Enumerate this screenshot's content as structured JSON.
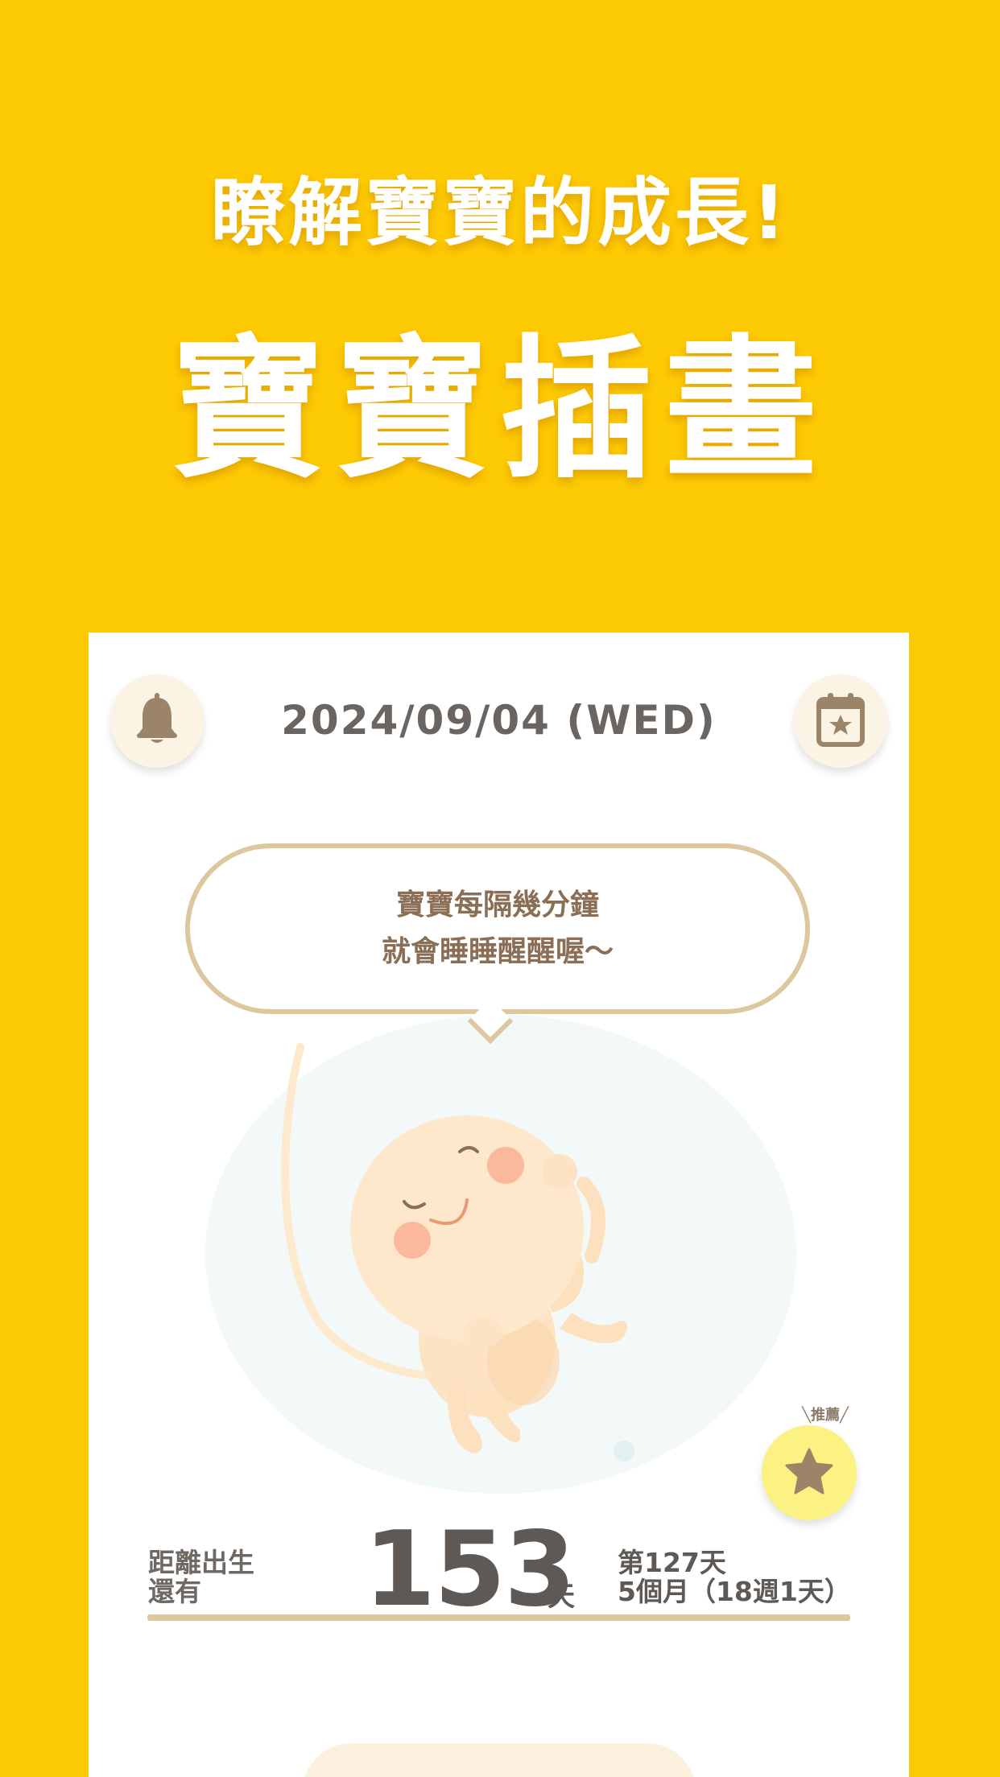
{
  "promo": {
    "subtitle": "瞭解寶寶的成長!",
    "title": "寶寶插畫"
  },
  "header": {
    "date": "2024/09/04 (WED)"
  },
  "bubble": {
    "line1": "寶寶每隔幾分鐘",
    "line2": "就會睡睡醒醒喔～"
  },
  "recommend": {
    "label": "╲推薦╱"
  },
  "countdown": {
    "label_line1": "距離出生",
    "label_line2": "還有",
    "days_left": "153",
    "unit": "天",
    "day_index": "第127天",
    "age": "5個月（18週1天）"
  },
  "colors": {
    "background": "#FCCA03",
    "accent_tan": "#DCC79E",
    "icon_brown": "#9C8468",
    "star_button": "#FCF283"
  },
  "icons": [
    "bell-icon",
    "calendar-star-icon",
    "star-icon"
  ]
}
